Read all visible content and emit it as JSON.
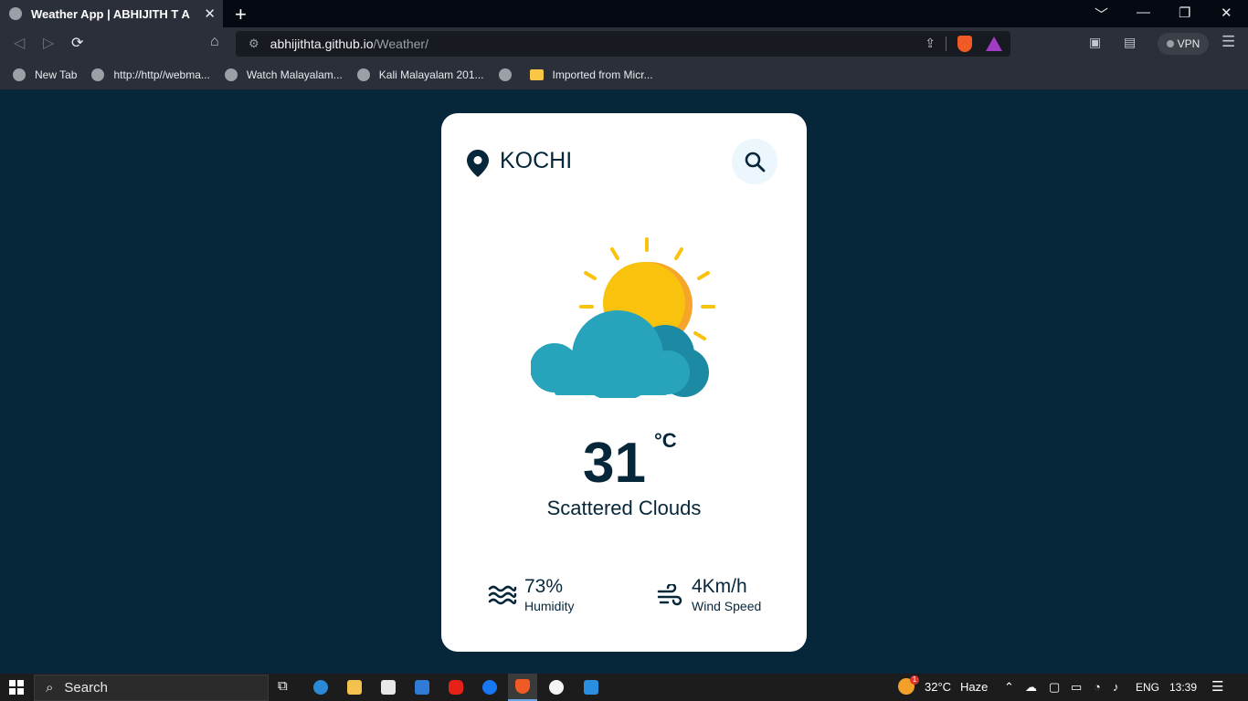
{
  "browser": {
    "tab_title": "Weather App | ABHIJITH T A",
    "tab_close": "✕",
    "new_tab": "+",
    "window_controls": [
      "﹀",
      "—",
      "❐",
      "✕"
    ],
    "url_host": "abhijithta.github.io",
    "url_path": "/Weather/",
    "vpn_label": "VPN",
    "bookmarks": [
      {
        "label": "New Tab",
        "icon": "globe-icon"
      },
      {
        "label": "http://http//webma...",
        "icon": "globe-icon"
      },
      {
        "label": "Watch Malayalam...",
        "icon": "globe-icon"
      },
      {
        "label": "Kali Malayalam 201...",
        "icon": "globe-icon"
      },
      {
        "label": "",
        "icon": "globe-icon"
      },
      {
        "label": "Imported from Micr...",
        "icon": "folder-icon"
      }
    ]
  },
  "weather": {
    "city": "KOCHI",
    "temperature": "31",
    "unit": "°C",
    "description": "Scattered Clouds",
    "humidity_value": "73%",
    "humidity_label": "Humidity",
    "wind_value": "4Km/h",
    "wind_label": "Wind Speed",
    "icon": "sun-behind-cloud-icon"
  },
  "taskbar": {
    "search_label": "Search",
    "weather_temp": "32°C",
    "weather_desc": "Haze",
    "weather_badge": "1",
    "language": "ENG",
    "time": "13:39"
  },
  "colors": {
    "page_bg": "#06263a",
    "card_bg": "#ffffff",
    "text_dark": "#06263a",
    "search_bg": "#ebf7fc",
    "sun": "#f9c20c",
    "sun_shade": "#f6a52a",
    "cloud": "#27a4bc",
    "cloud_shade": "#1c8aa3"
  }
}
